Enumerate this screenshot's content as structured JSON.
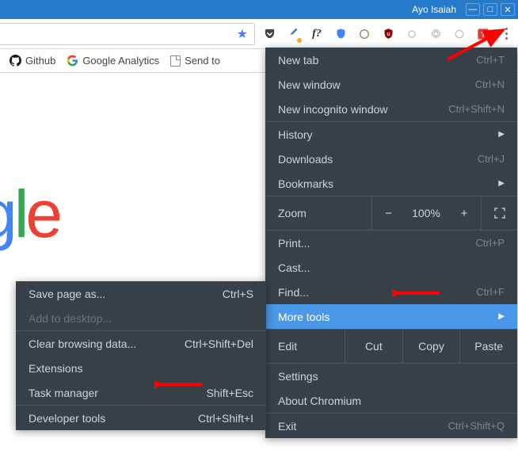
{
  "titlebar": {
    "user": "Ayo Isaiah"
  },
  "bookmarks": {
    "github": "Github",
    "ga": "Google Analytics",
    "sendto": "Send to"
  },
  "glogo": {
    "c1": "g",
    "c2": "l",
    "c3": "e"
  },
  "menu": {
    "new_tab": "New tab",
    "new_tab_sc": "Ctrl+T",
    "new_window": "New window",
    "new_window_sc": "Ctrl+N",
    "incognito": "New incognito window",
    "incognito_sc": "Ctrl+Shift+N",
    "history": "History",
    "downloads": "Downloads",
    "downloads_sc": "Ctrl+J",
    "bookmarks": "Bookmarks",
    "zoom": "Zoom",
    "zoom_val": "100%",
    "print": "Print...",
    "print_sc": "Ctrl+P",
    "cast": "Cast...",
    "find": "Find...",
    "find_sc": "Ctrl+F",
    "more_tools": "More tools",
    "edit": "Edit",
    "cut": "Cut",
    "copy": "Copy",
    "paste": "Paste",
    "settings": "Settings",
    "about": "About Chromium",
    "exit": "Exit",
    "exit_sc": "Ctrl+Shift+Q"
  },
  "submenu": {
    "save_page": "Save page as...",
    "save_page_sc": "Ctrl+S",
    "add_desktop": "Add to desktop...",
    "clear_data": "Clear browsing data...",
    "clear_data_sc": "Ctrl+Shift+Del",
    "extensions": "Extensions",
    "task_manager": "Task manager",
    "task_manager_sc": "Shift+Esc",
    "dev_tools": "Developer tools",
    "dev_tools_sc": "Ctrl+Shift+I"
  }
}
